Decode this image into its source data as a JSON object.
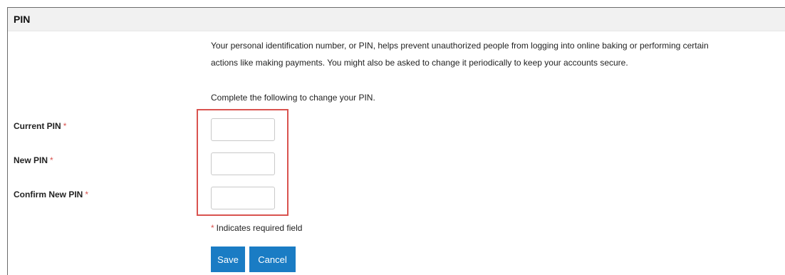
{
  "section": {
    "title": "PIN"
  },
  "intro": {
    "line1": "Your personal identification number, or PIN, helps prevent unauthorized people from logging into online baking or performing certain",
    "line2": "actions like making payments. You might also be asked to change it periodically to keep your accounts secure.",
    "instruction": "Complete the following to change your PIN."
  },
  "form": {
    "required_marker": "*",
    "current_pin": {
      "label": "Current PIN",
      "value": ""
    },
    "new_pin": {
      "label": "New PIN",
      "value": ""
    },
    "confirm_pin": {
      "label": "Confirm New PIN",
      "value": ""
    },
    "required_note": "Indicates required field",
    "save_label": "Save",
    "cancel_label": "Cancel"
  },
  "colors": {
    "button_bg": "#1a7cc4",
    "required_red": "#d9534f",
    "highlight_border": "#d9534f",
    "header_bg": "#f1f1f1"
  }
}
